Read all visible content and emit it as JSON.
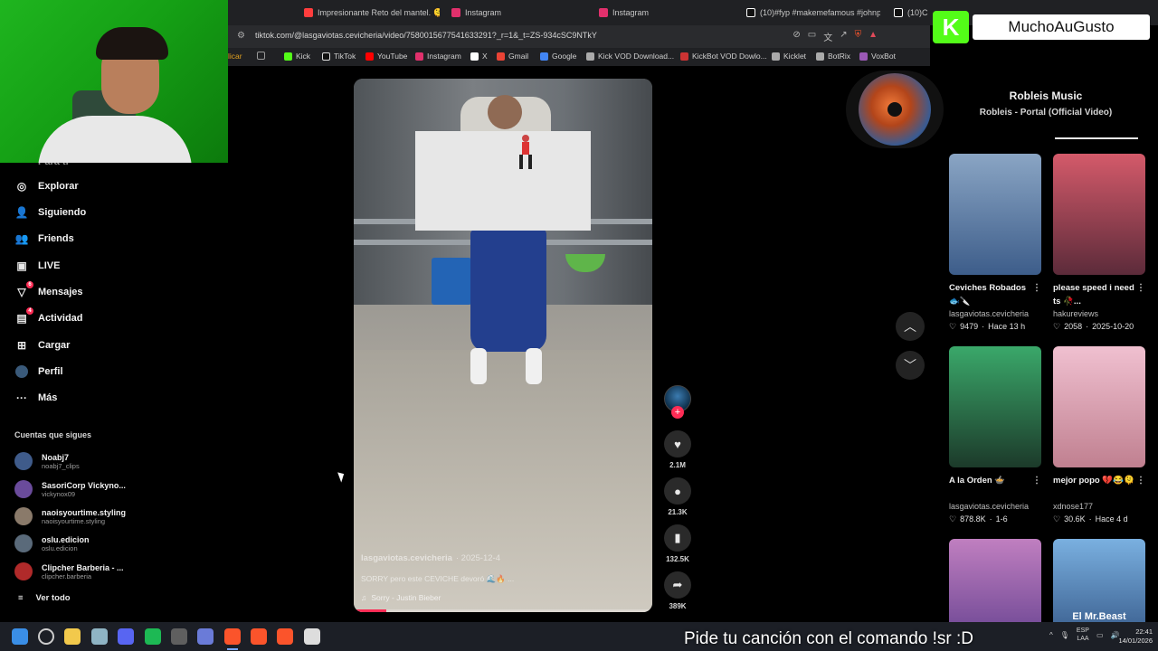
{
  "browser": {
    "tabs": [
      {
        "label": "Impresionante Reto del mantel. 🫠 #",
        "color": "#ff3d3d"
      },
      {
        "label": "Instagram",
        "color": "#e1306c"
      },
      {
        "label": "Instagram",
        "color": "#e1306c"
      },
      {
        "label": "(10)#fyp #makemefamous #johnpo",
        "color": "#ffffff"
      },
      {
        "label": "(10)C",
        "color": "#ffffff"
      }
    ],
    "url": "tiktok.com/@lasgaviotas.cevicheria/video/7580015677541633291?_r=1&_t=ZS-934cSC9NTkY",
    "bookmarks": [
      {
        "label": "licar",
        "color": "#e0a020"
      },
      {
        "label": "",
        "color": "#999999"
      },
      {
        "label": "Kick",
        "color": "#53fc18"
      },
      {
        "label": "TikTok",
        "color": "#ffffff"
      },
      {
        "label": "YouTube",
        "color": "#ff0000"
      },
      {
        "label": "Instagram",
        "color": "#e1306c"
      },
      {
        "label": "X",
        "color": "#ffffff"
      },
      {
        "label": "Gmail",
        "color": "#ea4335"
      },
      {
        "label": "Google",
        "color": "#4285f4"
      },
      {
        "label": "Kick VOD Download...",
        "color": "#aaaaaa"
      },
      {
        "label": "KickBot VOD Dowlo...",
        "color": "#cc3333"
      },
      {
        "label": "Kicklet",
        "color": "#aaaaaa"
      },
      {
        "label": "BotRix",
        "color": "#aaaaaa"
      },
      {
        "label": "VoxBot",
        "color": "#9b59b6"
      }
    ]
  },
  "overlay": {
    "logo_letter": "K",
    "logo_name": "MuchoAuGusto",
    "music_title": "Robleis Music",
    "music_subtitle": "Robleis - Portal (Official Video)",
    "ticker": "Pide tu canción con el comando !sr :D"
  },
  "sidebar": {
    "partial_top": "Para ti",
    "items": [
      {
        "label": "Explorar",
        "icon": "compass-icon",
        "badge": ""
      },
      {
        "label": "Siguiendo",
        "icon": "following-icon",
        "badge": ""
      },
      {
        "label": "Friends",
        "icon": "friends-icon",
        "badge": ""
      },
      {
        "label": "LIVE",
        "icon": "live-icon",
        "badge": ""
      },
      {
        "label": "Mensajes",
        "icon": "messages-icon",
        "badge": "6"
      },
      {
        "label": "Actividad",
        "icon": "activity-icon",
        "badge": "4"
      },
      {
        "label": "Cargar",
        "icon": "upload-icon",
        "badge": ""
      },
      {
        "label": "Perfil",
        "icon": "profile-icon",
        "badge": ""
      },
      {
        "label": "Más",
        "icon": "more-icon",
        "badge": ""
      }
    ],
    "following_title": "Cuentas que sigues",
    "following": [
      {
        "name": "Noabj7",
        "handle": "noabj7_clips",
        "color": "#3f5b8a"
      },
      {
        "name": "SasoriCorp Vickyno...",
        "handle": "vickynox09",
        "color": "#6a4b9b"
      },
      {
        "name": "naoisyourtime.styling",
        "handle": "naoisyourtime.styling",
        "color": "#8a7a6a"
      },
      {
        "name": "oslu.edicion",
        "handle": "oslu.edicion",
        "color": "#5a6a7a"
      },
      {
        "name": "Clipcher Barberia - ...",
        "handle": "clipcher.barberia",
        "color": "#b02a2a"
      }
    ],
    "see_all": "Ver todo"
  },
  "video": {
    "author": "lasgaviotas.cevicheria",
    "date": "· 2025-12-4",
    "caption": "SORRY pero este CEVICHE devoró 🌊🔥 ...",
    "music": "Sorry - Justin Bieber",
    "progress": 0.11,
    "likes": "2.1M",
    "comments": "21.3K",
    "saves": "132.5K",
    "shares": "389K"
  },
  "grid": [
    {
      "title": "Ceviches Robados 🐟🔪",
      "author": "lasgaviotas.cevicheria",
      "likes": "9479",
      "time": "Hace 13 h",
      "thumb": [
        "#8aa5c4",
        "#3d5d8a"
      ]
    },
    {
      "title": "please speed i need ts 🥀...",
      "author": "hakureviews",
      "likes": "2058",
      "time": "2025-10-20",
      "thumb": [
        "#d45a6a",
        "#5c2b3a"
      ]
    },
    {
      "title": "A la Orden 🍲",
      "author": "lasgaviotas.cevicheria",
      "likes": "878.8K",
      "time": "1-6",
      "thumb": [
        "#3aa86a",
        "#1c3a2a"
      ]
    },
    {
      "title": "mejor popo 💔😂🫠",
      "author": "xdnose177",
      "likes": "30.6K",
      "time": "Hace 4 d",
      "thumb": [
        "#f0c0d0",
        "#c08090"
      ]
    },
    {
      "title": "",
      "author": "",
      "likes": "",
      "time": "",
      "thumb": [
        "#c07fc0",
        "#5a3a8a"
      ]
    },
    {
      "title": "",
      "author": "",
      "likes": "",
      "time": "",
      "thumb": [
        "#7ab0e0",
        "#2a4a7a"
      ],
      "overlay_text": "El Mr.Beast"
    }
  ],
  "taskbar": {
    "lang": "ESP",
    "lang_sub": "LAA",
    "time": "22:41",
    "date": "14/01/2026",
    "apps": [
      {
        "name": "windows-start-icon",
        "color": "#3a8ee6"
      },
      {
        "name": "search-icon",
        "color": "#cccccc"
      },
      {
        "name": "file-explorer-icon",
        "color": "#f2c94c"
      },
      {
        "name": "obs-icon",
        "color": "#8fb4c4"
      },
      {
        "name": "discord-icon",
        "color": "#5865f2"
      },
      {
        "name": "spotify-icon",
        "color": "#1db954"
      },
      {
        "name": "chrome-icon",
        "color": "#5f5f5f"
      },
      {
        "name": "app-icon",
        "color": "#6a7bd8"
      },
      {
        "name": "brave-icon",
        "color": "#fb542b"
      },
      {
        "name": "brave-icon",
        "color": "#fb542b"
      },
      {
        "name": "brave-icon",
        "color": "#fb542b"
      },
      {
        "name": "notes-icon",
        "color": "#dddddd"
      }
    ]
  }
}
